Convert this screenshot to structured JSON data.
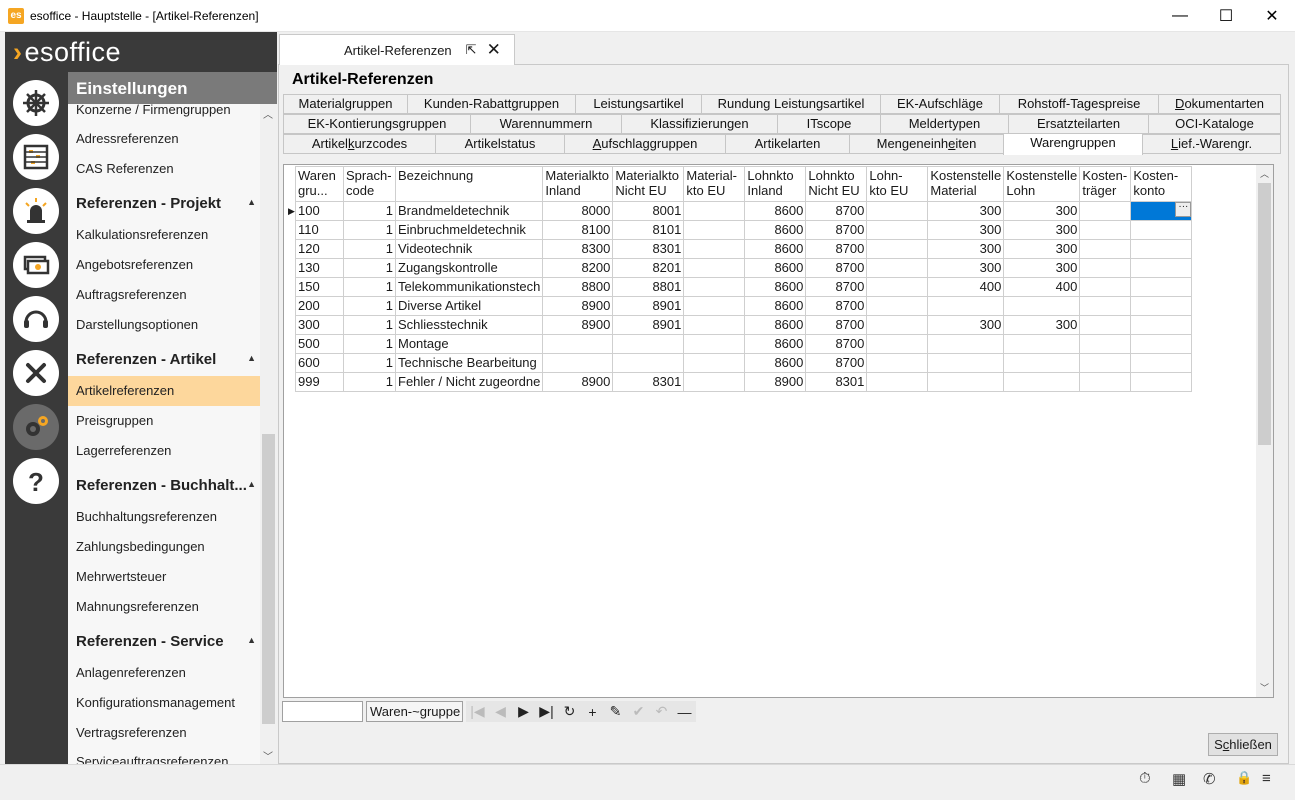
{
  "window": {
    "app_icon_text": "es",
    "title": "esoffice - Hauptstelle - [Artikel-Referenzen]",
    "min": "—",
    "max": "☐",
    "close": "✕"
  },
  "logo": {
    "chevron": "›",
    "text": "esoffice"
  },
  "sidebar_icons": [
    "helm-icon",
    "abacus-icon",
    "alarm-icon",
    "money-icon",
    "headset-icon",
    "tools-icon",
    "gears-icon",
    "help-icon"
  ],
  "nav": {
    "header": "Einstellungen",
    "items": [
      {
        "type": "item",
        "label": "Konzerne / Firmengruppen"
      },
      {
        "type": "item",
        "label": "Adressreferenzen"
      },
      {
        "type": "item",
        "label": "CAS Referenzen"
      },
      {
        "type": "section",
        "label": "Referenzen - Projekt"
      },
      {
        "type": "item",
        "label": "Kalkulationsreferenzen"
      },
      {
        "type": "item",
        "label": "Angebotsreferenzen"
      },
      {
        "type": "item",
        "label": "Auftragsreferenzen"
      },
      {
        "type": "item",
        "label": "Darstellungsoptionen"
      },
      {
        "type": "section",
        "label": "Referenzen - Artikel"
      },
      {
        "type": "item",
        "label": "Artikelreferenzen",
        "selected": true
      },
      {
        "type": "item",
        "label": "Preisgruppen"
      },
      {
        "type": "item",
        "label": "Lagerreferenzen"
      },
      {
        "type": "section",
        "label": "Referenzen - Buchhalt..."
      },
      {
        "type": "item",
        "label": "Buchhaltungsreferenzen"
      },
      {
        "type": "item",
        "label": "Zahlungsbedingungen"
      },
      {
        "type": "item",
        "label": "Mehrwertsteuer"
      },
      {
        "type": "item",
        "label": "Mahnungsreferenzen"
      },
      {
        "type": "section",
        "label": "Referenzen - Service"
      },
      {
        "type": "item",
        "label": "Anlagenreferenzen"
      },
      {
        "type": "item",
        "label": "Konfigurationsmanagement"
      },
      {
        "type": "item",
        "label": "Vertragsreferenzen"
      },
      {
        "type": "item",
        "label": "Serviceauftragsreferenzen"
      }
    ]
  },
  "doc_tab": {
    "label": "Artikel-Referenzen",
    "popout": "⇱",
    "close": "✕"
  },
  "page_title": "Artikel-Referenzen",
  "tabs": {
    "row1": [
      "Materialgruppen",
      "Kunden-Rabattgruppen",
      "Leistungsartikel",
      "Rundung Leistungsartikel",
      "EK-Aufschläge",
      "Rohstoff-Tagespreise",
      "Dokumentarten"
    ],
    "row2": [
      "EK-Kontierungsgruppen",
      "Warennummern",
      "Klassifizierungen",
      "ITscope",
      "Meldertypen",
      "Ersatzteilarten",
      "OCI-Kataloge"
    ],
    "row3": [
      "Artikelkurzcodes",
      "Artikelstatus",
      "Aufschlaggruppen",
      "Artikelarten",
      "Mengeneinheiten",
      "Warengruppen",
      "Lief.-Warengr."
    ],
    "active": "Warengruppen"
  },
  "grid": {
    "columns": [
      [
        "Waren",
        "gru..."
      ],
      [
        "Sprach-",
        "code"
      ],
      [
        "Bezeichnung",
        ""
      ],
      [
        "Materialkto",
        "Inland"
      ],
      [
        "Materialkto",
        "Nicht EU"
      ],
      [
        "Material-",
        "kto EU"
      ],
      [
        "Lohnkto",
        "Inland"
      ],
      [
        "Lohnkto",
        "Nicht EU"
      ],
      [
        "Lohn-",
        "kto EU"
      ],
      [
        "Kostenstelle",
        "Material"
      ],
      [
        "Kostenstelle",
        "Lohn"
      ],
      [
        "Kosten-",
        "träger"
      ],
      [
        "Kosten-",
        "konto"
      ]
    ],
    "rows": [
      [
        "100",
        "1",
        "Brandmeldetechnik",
        "8000",
        "8001",
        "",
        "8600",
        "8700",
        "",
        "300",
        "300",
        "",
        ""
      ],
      [
        "110",
        "1",
        "Einbruchmeldetechnik",
        "8100",
        "8101",
        "",
        "8600",
        "8700",
        "",
        "300",
        "300",
        "",
        ""
      ],
      [
        "120",
        "1",
        "Videotechnik",
        "8300",
        "8301",
        "",
        "8600",
        "8700",
        "",
        "300",
        "300",
        "",
        ""
      ],
      [
        "130",
        "1",
        "Zugangskontrolle",
        "8200",
        "8201",
        "",
        "8600",
        "8700",
        "",
        "300",
        "300",
        "",
        ""
      ],
      [
        "150",
        "1",
        "Telekommunikationstech",
        "8800",
        "8801",
        "",
        "8600",
        "8700",
        "",
        "400",
        "400",
        "",
        ""
      ],
      [
        "200",
        "1",
        "Diverse Artikel",
        "8900",
        "8901",
        "",
        "8600",
        "8700",
        "",
        "",
        "",
        "",
        ""
      ],
      [
        "300",
        "1",
        "Schliesstechnik",
        "8900",
        "8901",
        "",
        "8600",
        "8700",
        "",
        "300",
        "300",
        "",
        ""
      ],
      [
        "500",
        "1",
        "Montage",
        "",
        "",
        "",
        "8600",
        "8700",
        "",
        "",
        "",
        "",
        ""
      ],
      [
        "600",
        "1",
        "Technische Bearbeitung",
        "",
        "",
        "",
        "8600",
        "8700",
        "",
        "",
        "",
        "",
        ""
      ],
      [
        "999",
        "1",
        "Fehler / Nicht zugeordne",
        "8900",
        "8301",
        "",
        "8900",
        "8301",
        "",
        "",
        "",
        "",
        ""
      ]
    ],
    "ellipsis": "···"
  },
  "navigator": {
    "search_value": "",
    "field_label": "Waren-~gruppe",
    "buttons": [
      "|◀",
      "◀",
      "▶",
      "▶|",
      "↻",
      "+",
      "✎",
      "✔",
      "↶",
      "—"
    ]
  },
  "close_button": {
    "prefix": "S",
    "underlined": "c",
    "rest": "hließen"
  },
  "status_icons": [
    "⏱",
    "▦",
    "✆",
    "🔒",
    "≡"
  ]
}
